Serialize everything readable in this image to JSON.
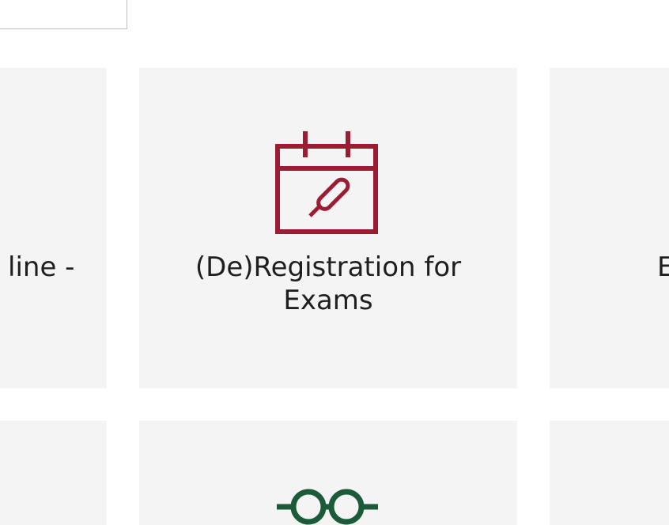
{
  "search": {
    "placeholder": ""
  },
  "tiles_row1": {
    "left": {
      "label": "line -"
    },
    "center": {
      "label_line1": "(De)Registration for",
      "label_line2": "Exams",
      "icon": "calendar-edit-icon",
      "icon_color": "#9c1c34"
    },
    "right": {
      "label": "E"
    }
  },
  "tiles_row2": {
    "center": {
      "icon": "glasses-icon",
      "icon_color": "#1c5b3a"
    }
  },
  "colors": {
    "tile_background": "#f4f4f4",
    "text": "#1f1f1f",
    "accent_red": "#9c1c34",
    "accent_green": "#1c5b3a"
  }
}
